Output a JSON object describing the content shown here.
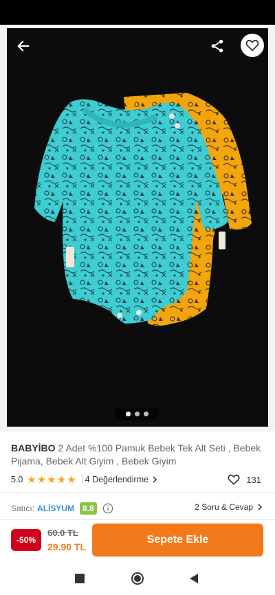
{
  "gallery": {
    "image_alt": "Baby bodysuits product photo",
    "slide_count": 3,
    "active_slide": 1
  },
  "icons": {
    "back": "arrow-left-icon",
    "share": "share-icon",
    "favorite": "heart-outline-icon",
    "star": "star-filled-icon",
    "chevron": "chevron-right-icon",
    "info": "info-circle-icon"
  },
  "product": {
    "brand": "BABYİBO",
    "name": "2 Adet %100 Pamuk Bebek Tek Alt Seti , Bebek Pijama, Bebek Alt Giyim , Bebek Giyim"
  },
  "rating": {
    "score": "5.0",
    "stars": 5,
    "reviews_text": "4 Değerlendirme",
    "favorites_count": "131"
  },
  "seller": {
    "label": "Satıcı:",
    "name": "ALİSYUM",
    "score": "8.8",
    "qa_text": "2 Soru & Cevap"
  },
  "purchase": {
    "discount": "-50%",
    "old_price": "60.0 TL",
    "new_price": "29.90 TL",
    "add_to_cart_label": "Sepete Ekle"
  },
  "colors": {
    "accent": "#f27a1a",
    "discount": "#d0021b",
    "seller_link": "#3a8fd6",
    "seller_score": "#8bc34a",
    "star": "#f5a623"
  }
}
